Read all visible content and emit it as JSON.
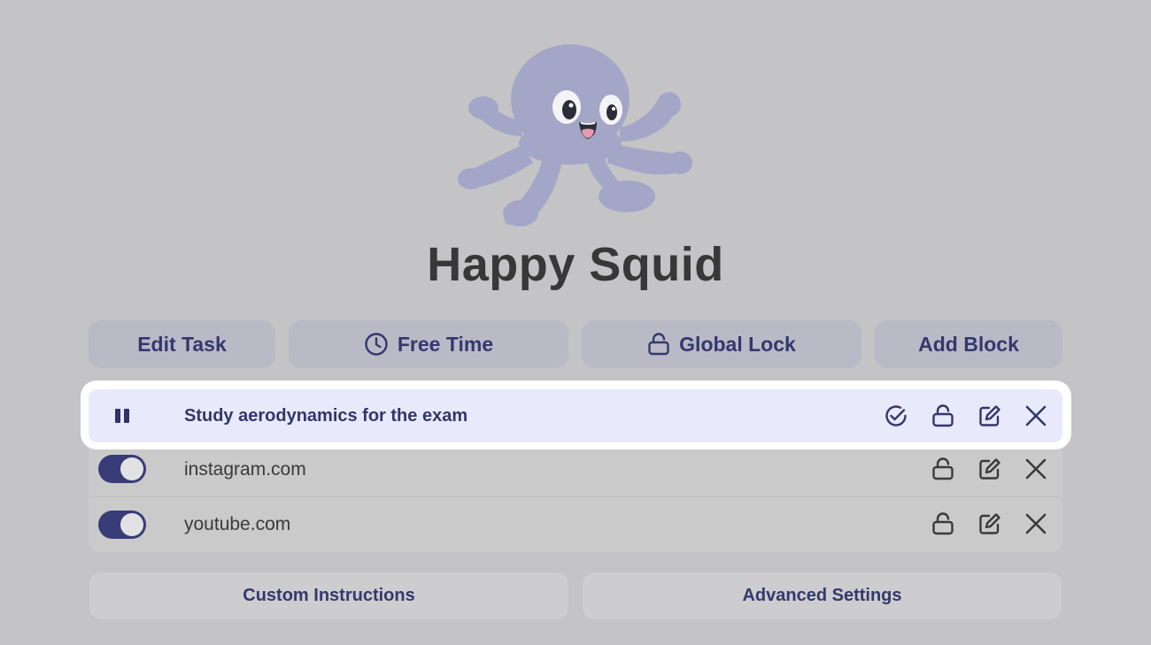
{
  "app": {
    "title": "Happy Squid",
    "mascot_icon": "octopus-mascot-icon",
    "colors": {
      "background": "#c4c4c6",
      "accent": "#34386e",
      "button_bg": "#babac7",
      "task_row_bg": "#e8e9fb",
      "toggle_on": "#383d78"
    }
  },
  "toolbar": {
    "edit_task": {
      "label": "Edit Task"
    },
    "free_time": {
      "label": "Free Time",
      "icon": "clock-icon"
    },
    "global_lock": {
      "label": "Global Lock",
      "icon": "lock-icon"
    },
    "add_block": {
      "label": "Add Block"
    }
  },
  "task": {
    "label": "Study aerodynamics for the exam",
    "state": "running",
    "icons": [
      "pause-icon",
      "check-circle-icon",
      "unlock-icon",
      "edit-icon",
      "close-icon"
    ]
  },
  "blocks": [
    {
      "label": "instagram.com",
      "enabled": true,
      "icons": [
        "unlock-icon",
        "edit-icon",
        "close-icon"
      ]
    },
    {
      "label": "youtube.com",
      "enabled": true,
      "icons": [
        "unlock-icon",
        "edit-icon",
        "close-icon"
      ]
    }
  ],
  "footer": {
    "custom_instructions": {
      "label": "Custom Instructions"
    },
    "advanced_settings": {
      "label": "Advanced Settings"
    }
  }
}
